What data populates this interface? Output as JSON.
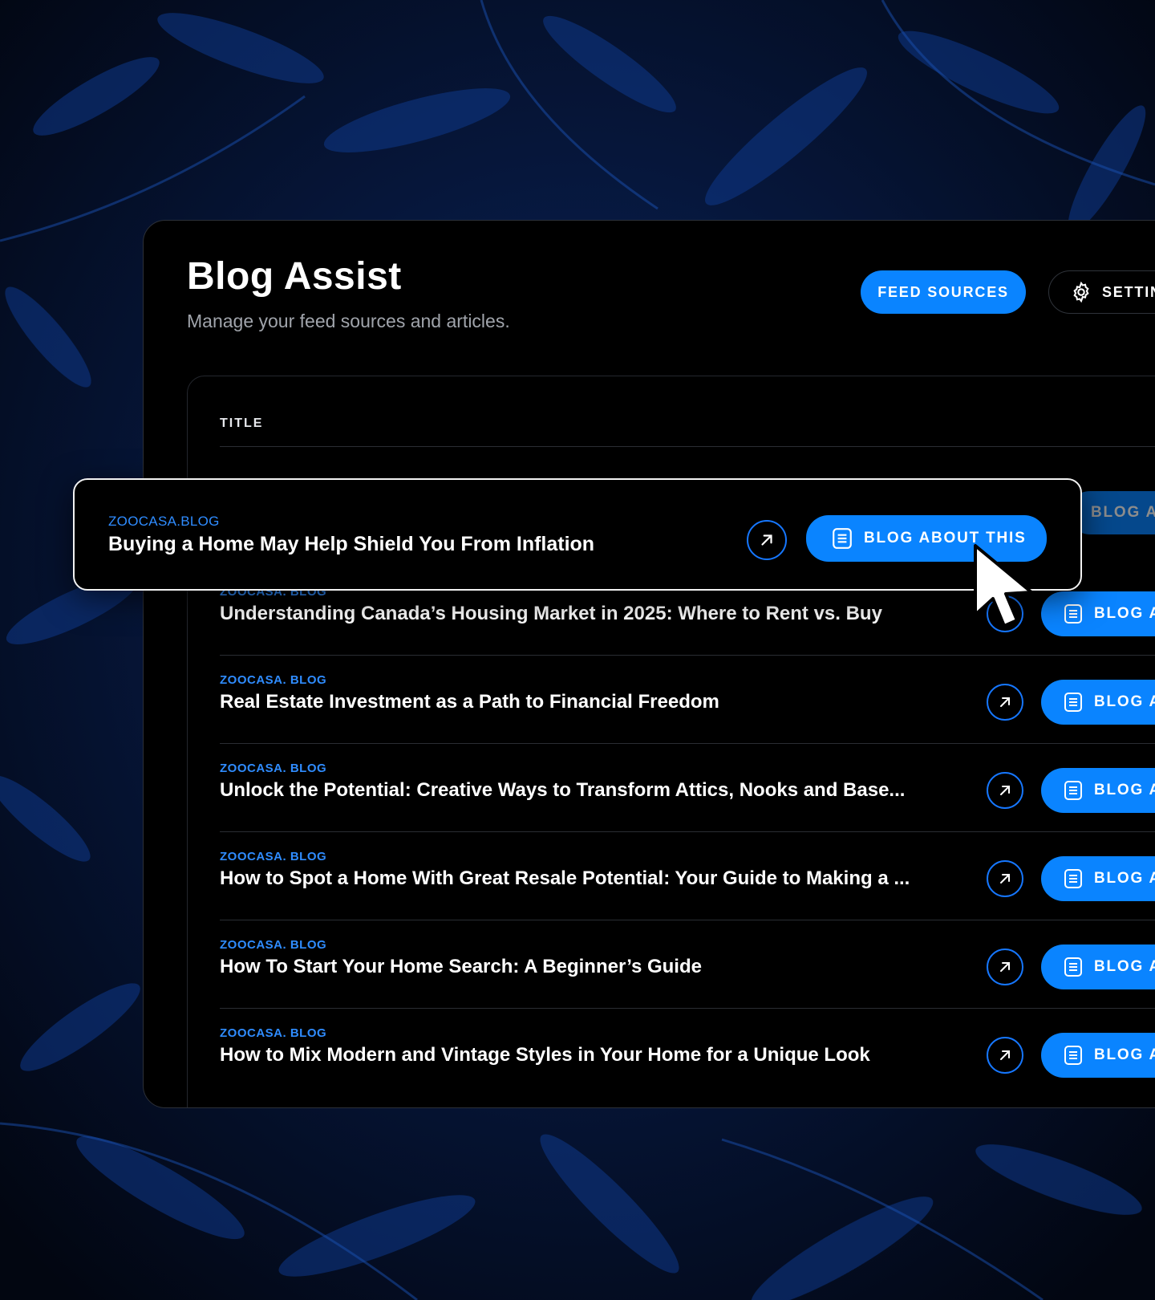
{
  "app": {
    "title": "Blog Assist",
    "subtitle": "Manage your feed sources and articles."
  },
  "header": {
    "feed_sources_label": "FEED SOURCES",
    "settings_label": "SETTIN"
  },
  "table": {
    "column_title": "TITLE",
    "ghost_button_label": "BLOG A"
  },
  "highlighted_article": {
    "source": "ZOOCASA.BLOG",
    "title": "Buying a Home May Help Shield You From Inflation",
    "action_label": "BLOG ABOUT THIS"
  },
  "articles": [
    {
      "source": "ZOOCASA. BLOG",
      "title": "Understanding Canada’s Housing Market in 2025: Where to Rent vs. Buy",
      "action_label": "BLOG A"
    },
    {
      "source": "ZOOCASA. BLOG",
      "title": "Real Estate Investment as a Path to Financial Freedom",
      "action_label": "BLOG A"
    },
    {
      "source": "ZOOCASA. BLOG",
      "title": "Unlock the Potential: Creative Ways to Transform Attics, Nooks and Base...",
      "action_label": "BLOG A"
    },
    {
      "source": "ZOOCASA. BLOG",
      "title": "How to Spot a Home With Great Resale Potential: Your Guide to Making a ...",
      "action_label": "BLOG A"
    },
    {
      "source": "ZOOCASA. BLOG",
      "title": "How To Start Your Home Search: A Beginner’s Guide",
      "action_label": "BLOG A"
    },
    {
      "source": "ZOOCASA. BLOG",
      "title": "How to Mix Modern and Vintage Styles in Your Home for a Unique Look",
      "action_label": "BLOG A"
    }
  ],
  "icons": {
    "settings": "gear-icon",
    "open": "arrow-up-right-icon",
    "blog": "document-icon",
    "pointer": "cursor-icon"
  },
  "colors": {
    "accent": "#0a84ff",
    "source_text": "#2f8cff",
    "panel_bg": "#000000",
    "page_bg": "#03091a"
  }
}
